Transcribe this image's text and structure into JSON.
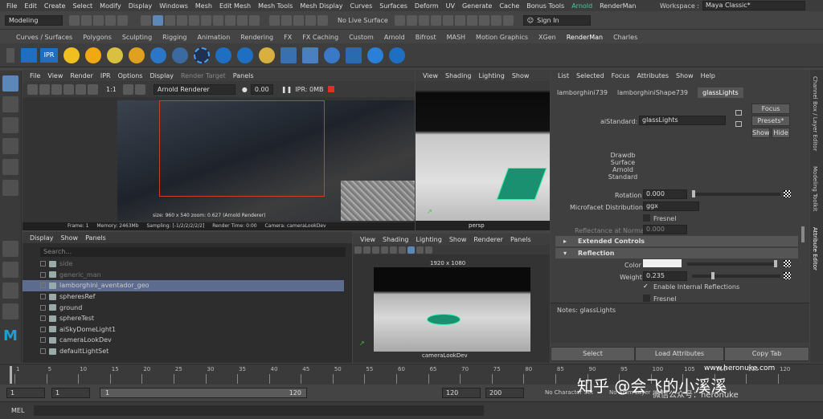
{
  "menubar": {
    "items": [
      "File",
      "Edit",
      "Create",
      "Select",
      "Modify",
      "Display",
      "Windows",
      "Mesh",
      "Edit Mesh",
      "Mesh Tools",
      "Mesh Display",
      "Curves",
      "Surfaces",
      "Deform",
      "UV",
      "Generate",
      "Cache",
      "Bonus Tools"
    ],
    "arnold": "Arnold",
    "renderman": "RenderMan",
    "workspace_label": "Workspace :",
    "workspace_value": "Maya Classic*"
  },
  "statusline": {
    "mode": "Modeling",
    "live_surface": "No Live Surface",
    "sign_in": "Sign In"
  },
  "shelf": {
    "tabs": [
      "Curves / Surfaces",
      "Polygons",
      "Sculpting",
      "Rigging",
      "Animation",
      "Rendering",
      "FX",
      "FX Caching",
      "Custom",
      "Arnold",
      "Bifrost",
      "MASH",
      "Motion Graphics",
      "XGen",
      "RenderMan",
      "Charles"
    ],
    "active": "RenderMan",
    "ipr_label": "IPR"
  },
  "renderview": {
    "menu": [
      "File",
      "View",
      "Render",
      "IPR",
      "Options",
      "Display",
      "Render Target",
      "Panels"
    ],
    "ratio": "1:1",
    "renderer": "Arnold Renderer",
    "exposure": "0.00",
    "ipr_mem": "IPR: 0MB",
    "size_info": "size: 960 x 540  zoom: 0.627    (Arnold Renderer)",
    "frame": "Frame: 1",
    "memory": "Memory: 2463Mb",
    "sampling": "Sampling: [-1/2/2/2/2/2]",
    "render_time": "Render Time: 0:00",
    "camera": "Camera: cameraLookDev"
  },
  "persp": {
    "menu": [
      "View",
      "Shading",
      "Lighting",
      "Show"
    ],
    "label": "persp"
  },
  "outliner": {
    "menu": [
      "Display",
      "Show",
      "Panels"
    ],
    "search_placeholder": "Search...",
    "items": [
      "side",
      "generic_man",
      "lamborghini_aventador_geo",
      "spheresRef",
      "ground",
      "sphereTest",
      "aiSkyDomeLight1",
      "cameraLookDev",
      "defaultLightSet"
    ]
  },
  "cameraview": {
    "menu": [
      "View",
      "Shading",
      "Lighting",
      "Show",
      "Renderer",
      "Panels"
    ],
    "resolution": "1920 x 1080",
    "label": "cameraLookDev"
  },
  "attr": {
    "menu": [
      "List",
      "Selected",
      "Focus",
      "Attributes",
      "Show",
      "Help"
    ],
    "tabs": [
      "lamborghini739",
      "lamborghiniShape739",
      "glassLights"
    ],
    "type_label": "aiStandard:",
    "type_value": "glassLights",
    "focus": "Focus",
    "presets": "Presets*",
    "show": "Show",
    "hide": "Hide",
    "swatch_lines": [
      "Drawdb",
      "Surface",
      "Arnold",
      "Standard"
    ],
    "rotation_label": "Rotation",
    "rotation_value": "0.000",
    "microfacet_label": "Microfacet Distribution",
    "microfacet_value": "ggx",
    "fresnel": "Fresnel",
    "reflectance_label": "Reflectance at Normal",
    "reflectance_value": "0.000",
    "extended": "Extended Controls",
    "reflection": "Reflection",
    "color_label": "Color",
    "weight_label": "Weight",
    "weight_value": "0.235",
    "internal": "Enable Internal Reflections",
    "fresnel2": "Fresnel",
    "notes": "Notes:  glassLights",
    "select": "Select",
    "load": "Load Attributes",
    "copy": "Copy Tab"
  },
  "sidetabs": [
    "Channel Box / Layer Editor",
    "Modeling Toolkit",
    "Attribute Editor"
  ],
  "timeline": {
    "ticks": [
      "1",
      "5",
      "10",
      "15",
      "20",
      "25",
      "30",
      "35",
      "40",
      "45",
      "50",
      "55",
      "60",
      "65",
      "70",
      "75",
      "80",
      "85",
      "90",
      "95",
      "100",
      "105",
      "110",
      "115",
      "120"
    ],
    "watermark_url": "www.heronuke.com"
  },
  "range": {
    "start": "1",
    "start2": "1",
    "slider_start": "1",
    "slider_end": "120",
    "end": "120",
    "end2": "200",
    "character_set": "No Character Set",
    "anim_layer": "No Anim Layer"
  },
  "cmdline": {
    "lang": "MEL"
  },
  "watermark": {
    "zhihu": "知乎 @会飞的小溪溪",
    "wechat": "微信公众号：heronuke"
  }
}
